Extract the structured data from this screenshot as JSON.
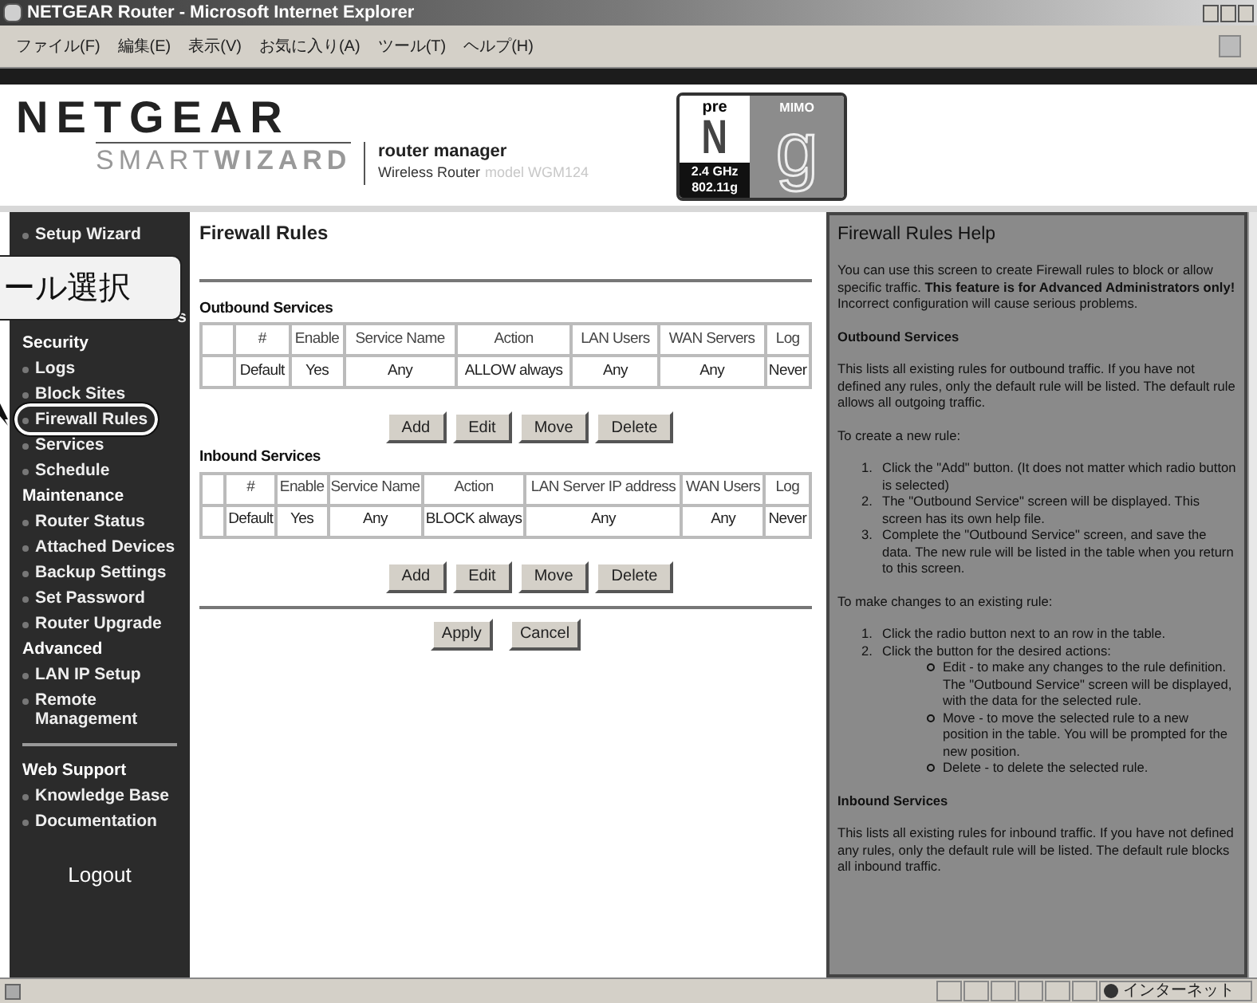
{
  "window": {
    "title": "NETGEAR Router - Microsoft Internet Explorer"
  },
  "menu": [
    "ファイル(F)",
    "編集(E)",
    "表示(V)",
    "お気に入り(A)",
    "ツール(T)",
    "ヘルプ(H)"
  ],
  "header": {
    "logo": "NETGEAR",
    "product": "SMART**WIZARD**",
    "tagline": "router manager",
    "device": "Wireless Router",
    "model": "model WGM124",
    "badge": {
      "pre": "pre",
      "letter": "N",
      "freq": "2.4 GHz",
      "standard": "802.11g",
      "mimo": "MIMO",
      "big": "g"
    }
  },
  "annotation": {
    "callout": "ール選択"
  },
  "sidebar": {
    "items": [
      {
        "kind": "link",
        "text": "Setup Wizard",
        "circled": false
      },
      {
        "kind": "divider"
      },
      {
        "kind": "covered",
        "text": "s"
      },
      {
        "kind": "heading",
        "text": "Security"
      },
      {
        "kind": "link",
        "text": "Logs",
        "circled": false
      },
      {
        "kind": "link",
        "text": "Block Sites",
        "circled": false
      },
      {
        "kind": "link",
        "text": "Firewall Rules",
        "circled": true
      },
      {
        "kind": "link",
        "text": "Services",
        "circled": false
      },
      {
        "kind": "link",
        "text": "Schedule",
        "circled": false
      },
      {
        "kind": "heading",
        "text": "Maintenance"
      },
      {
        "kind": "link",
        "text": "Router Status",
        "circled": false
      },
      {
        "kind": "link",
        "text": "Attached Devices",
        "circled": false
      },
      {
        "kind": "link",
        "text": "Backup Settings",
        "circled": false
      },
      {
        "kind": "link",
        "text": "Set Password",
        "circled": false
      },
      {
        "kind": "link",
        "text": "Router Upgrade",
        "circled": false
      },
      {
        "kind": "heading",
        "text": "Advanced"
      },
      {
        "kind": "link",
        "text": "LAN IP Setup",
        "circled": false
      },
      {
        "kind": "link",
        "text": "Remote Management",
        "circled": false
      },
      {
        "kind": "divider"
      },
      {
        "kind": "heading",
        "text": "Web Support"
      },
      {
        "kind": "link",
        "text": "Knowledge Base",
        "circled": false
      },
      {
        "kind": "link",
        "text": "Documentation",
        "circled": false
      },
      {
        "kind": "logout",
        "text": "Logout"
      }
    ]
  },
  "main": {
    "title": "Firewall Rules",
    "sections": [
      {
        "title": "Outbound Services",
        "columns": [
          "#",
          "Enable",
          "Service Name",
          "Action",
          "LAN Users",
          "WAN Servers",
          "Log"
        ],
        "rows": [
          [
            "Default",
            "Yes",
            "Any",
            "ALLOW always",
            "Any",
            "Any",
            "Never"
          ]
        ],
        "buttons": [
          "Add",
          "Edit",
          "Move",
          "Delete"
        ]
      },
      {
        "title": "Inbound Services",
        "columns": [
          "#",
          "Enable",
          "Service Name",
          "Action",
          "LAN Server IP address",
          "WAN Users",
          "Log"
        ],
        "rows": [
          [
            "Default",
            "Yes",
            "Any",
            "BLOCK always",
            "Any",
            "Any",
            "Never"
          ]
        ],
        "buttons": [
          "Add",
          "Edit",
          "Move",
          "Delete"
        ]
      }
    ],
    "buttons": [
      "Apply",
      "Cancel"
    ]
  },
  "help": {
    "title": "Firewall Rules Help",
    "blocks": [
      {
        "kind": "p",
        "text": "You can use this screen to create Firewall rules to block or allow specific traffic. **This feature is for Advanced Administrators only!** Incorrect configuration will cause serious problems."
      },
      {
        "kind": "h",
        "text": "Outbound Services"
      },
      {
        "kind": "p",
        "text": "This lists all existing rules for outbound traffic. If you have not defined any rules, only the default rule will be listed. The default rule allows all outgoing traffic."
      },
      {
        "kind": "p",
        "text": "To create a new rule:"
      },
      {
        "kind": "ol",
        "items": [
          {
            "num": "1.",
            "text": "Click the \"Add\" button. (It does not matter which radio button is selected)"
          },
          {
            "num": "2.",
            "text": "The \"Outbound Service\" screen will be displayed. This screen has its own help file."
          },
          {
            "num": "3.",
            "text": "Complete the \"Outbound Service\" screen, and save the data. The new rule will be listed in the table when you return to this screen."
          }
        ]
      },
      {
        "kind": "p",
        "text": "To make changes to an existing rule:"
      },
      {
        "kind": "ol",
        "items": [
          {
            "num": "1.",
            "text": "Click the radio button next to an row in the table."
          },
          {
            "num": "2.",
            "text": "Click the button for the desired actions:",
            "children": [
              {
                "text": "Edit - to make any changes to the rule definition. The \"Outbound Service\" screen will be displayed, with the data for the selected rule."
              },
              {
                "text": "Move - to move the selected rule to a new position in the table. You will be prompted for the new position."
              },
              {
                "text": "Delete - to delete the selected rule."
              }
            ]
          }
        ]
      },
      {
        "kind": "h",
        "text": "Inbound Services"
      },
      {
        "kind": "p",
        "text": "This lists all existing rules for inbound traffic. If you have not defined any rules, only the default rule will be listed. The default rule blocks all inbound traffic."
      }
    ]
  },
  "status_bar": {
    "zone": "インターネット"
  }
}
